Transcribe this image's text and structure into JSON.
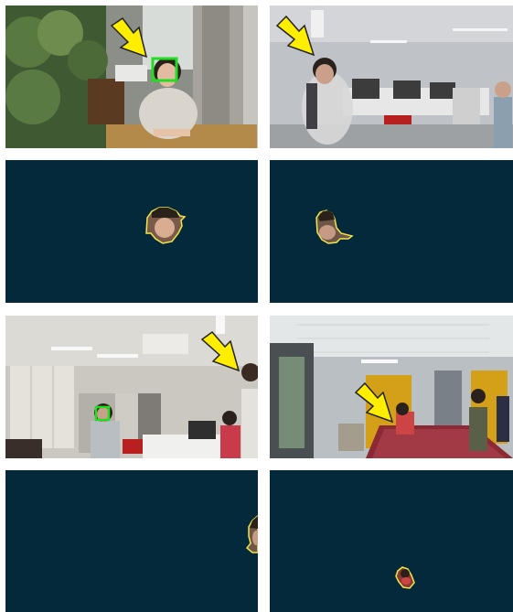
{
  "colors": {
    "mask_background": "#03293a",
    "face_box": "#22dd22",
    "arrow": "#ffee00",
    "contour": "#f2e64a"
  },
  "panels": [
    {
      "kind": "photo",
      "scene": "outdoor-patio",
      "markers": [
        "arrow",
        "face-box"
      ]
    },
    {
      "kind": "photo",
      "scene": "office-walking",
      "markers": [
        "arrow"
      ]
    },
    {
      "kind": "segmentation-mask",
      "markers": [
        "head-contour"
      ]
    },
    {
      "kind": "segmentation-mask",
      "markers": [
        "head-contour"
      ]
    },
    {
      "kind": "photo",
      "scene": "office-room",
      "markers": [
        "arrow",
        "face-box"
      ]
    },
    {
      "kind": "photo",
      "scene": "billiard-room",
      "markers": [
        "arrow"
      ]
    },
    {
      "kind": "segmentation-mask",
      "markers": [
        "head-contour"
      ]
    },
    {
      "kind": "segmentation-mask",
      "markers": [
        "head-contour"
      ]
    }
  ]
}
